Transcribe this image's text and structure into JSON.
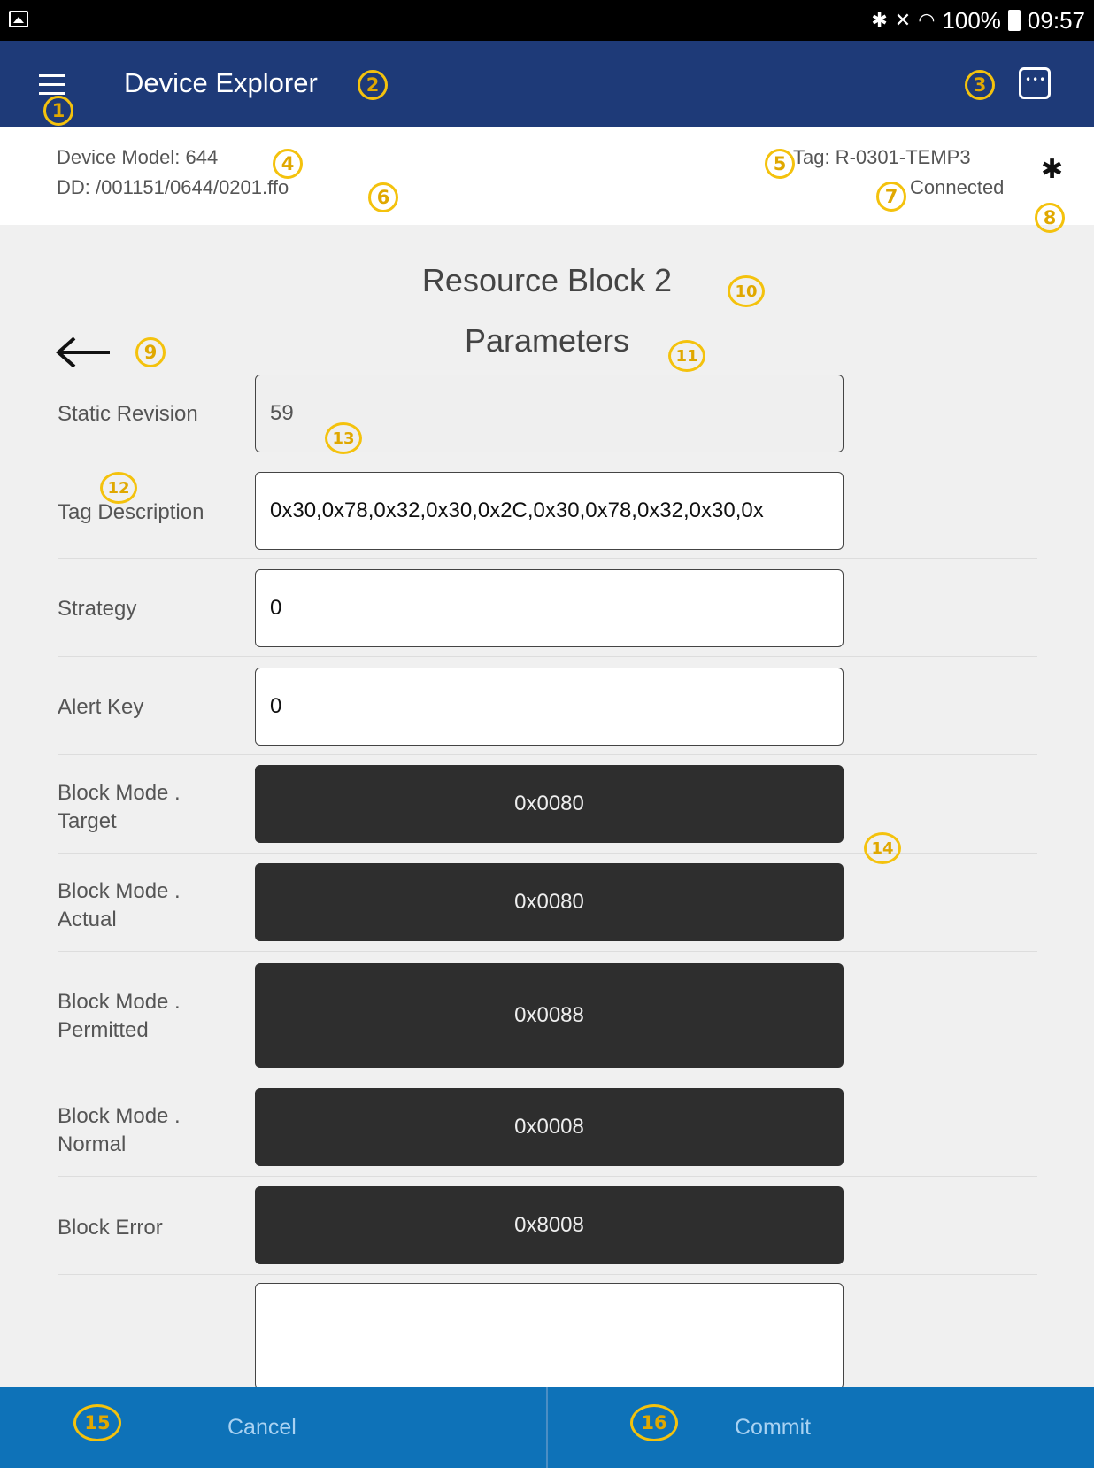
{
  "status_bar": {
    "battery": "100%",
    "time": "09:57",
    "icons": [
      "gallery-icon",
      "bluetooth-icon",
      "mute-icon",
      "wifi-icon",
      "battery-icon"
    ]
  },
  "app_bar": {
    "title": "Device Explorer",
    "bg_color": "#1e3a78"
  },
  "device_info": {
    "model_label": "Device Model:",
    "model_value": "644",
    "dd_label": "DD:",
    "dd_value": "/001151/0644/0201.ffo",
    "tag_label": "Tag:",
    "tag_value": "R-0301-TEMP3",
    "connection_status": "Connected"
  },
  "block_title": "Resource Block 2",
  "section_title": "Parameters",
  "parameters": [
    {
      "label": "Static Revision",
      "value": "59"
    },
    {
      "label": "Tag Description",
      "value": "0x30,0x78,0x32,0x30,0x2C,0x30,0x78,0x32,0x30,0x"
    },
    {
      "label": "Strategy",
      "value": "0"
    },
    {
      "label": "Alert Key",
      "value": "0"
    },
    {
      "label_line1": "Block Mode .",
      "label_line2": "Target",
      "value": "0x0080"
    },
    {
      "label_line1": "Block Mode .",
      "label_line2": "Actual",
      "value": "0x0080"
    },
    {
      "label_line1": "Block Mode .",
      "label_line2": "Permitted",
      "value": "0x0088"
    },
    {
      "label_line1": "Block Mode .",
      "label_line2": "Normal",
      "value": "0x0008"
    },
    {
      "label": "Block Error",
      "value": "0x8008"
    }
  ],
  "bottom_bar": {
    "cancel_label": "Cancel",
    "commit_label": "Commit",
    "bg_color": "#0e72b8"
  },
  "callouts": [
    "1",
    "2",
    "3",
    "4",
    "5",
    "6",
    "7",
    "8",
    "9",
    "10",
    "11",
    "12",
    "13",
    "14",
    "15",
    "16"
  ]
}
